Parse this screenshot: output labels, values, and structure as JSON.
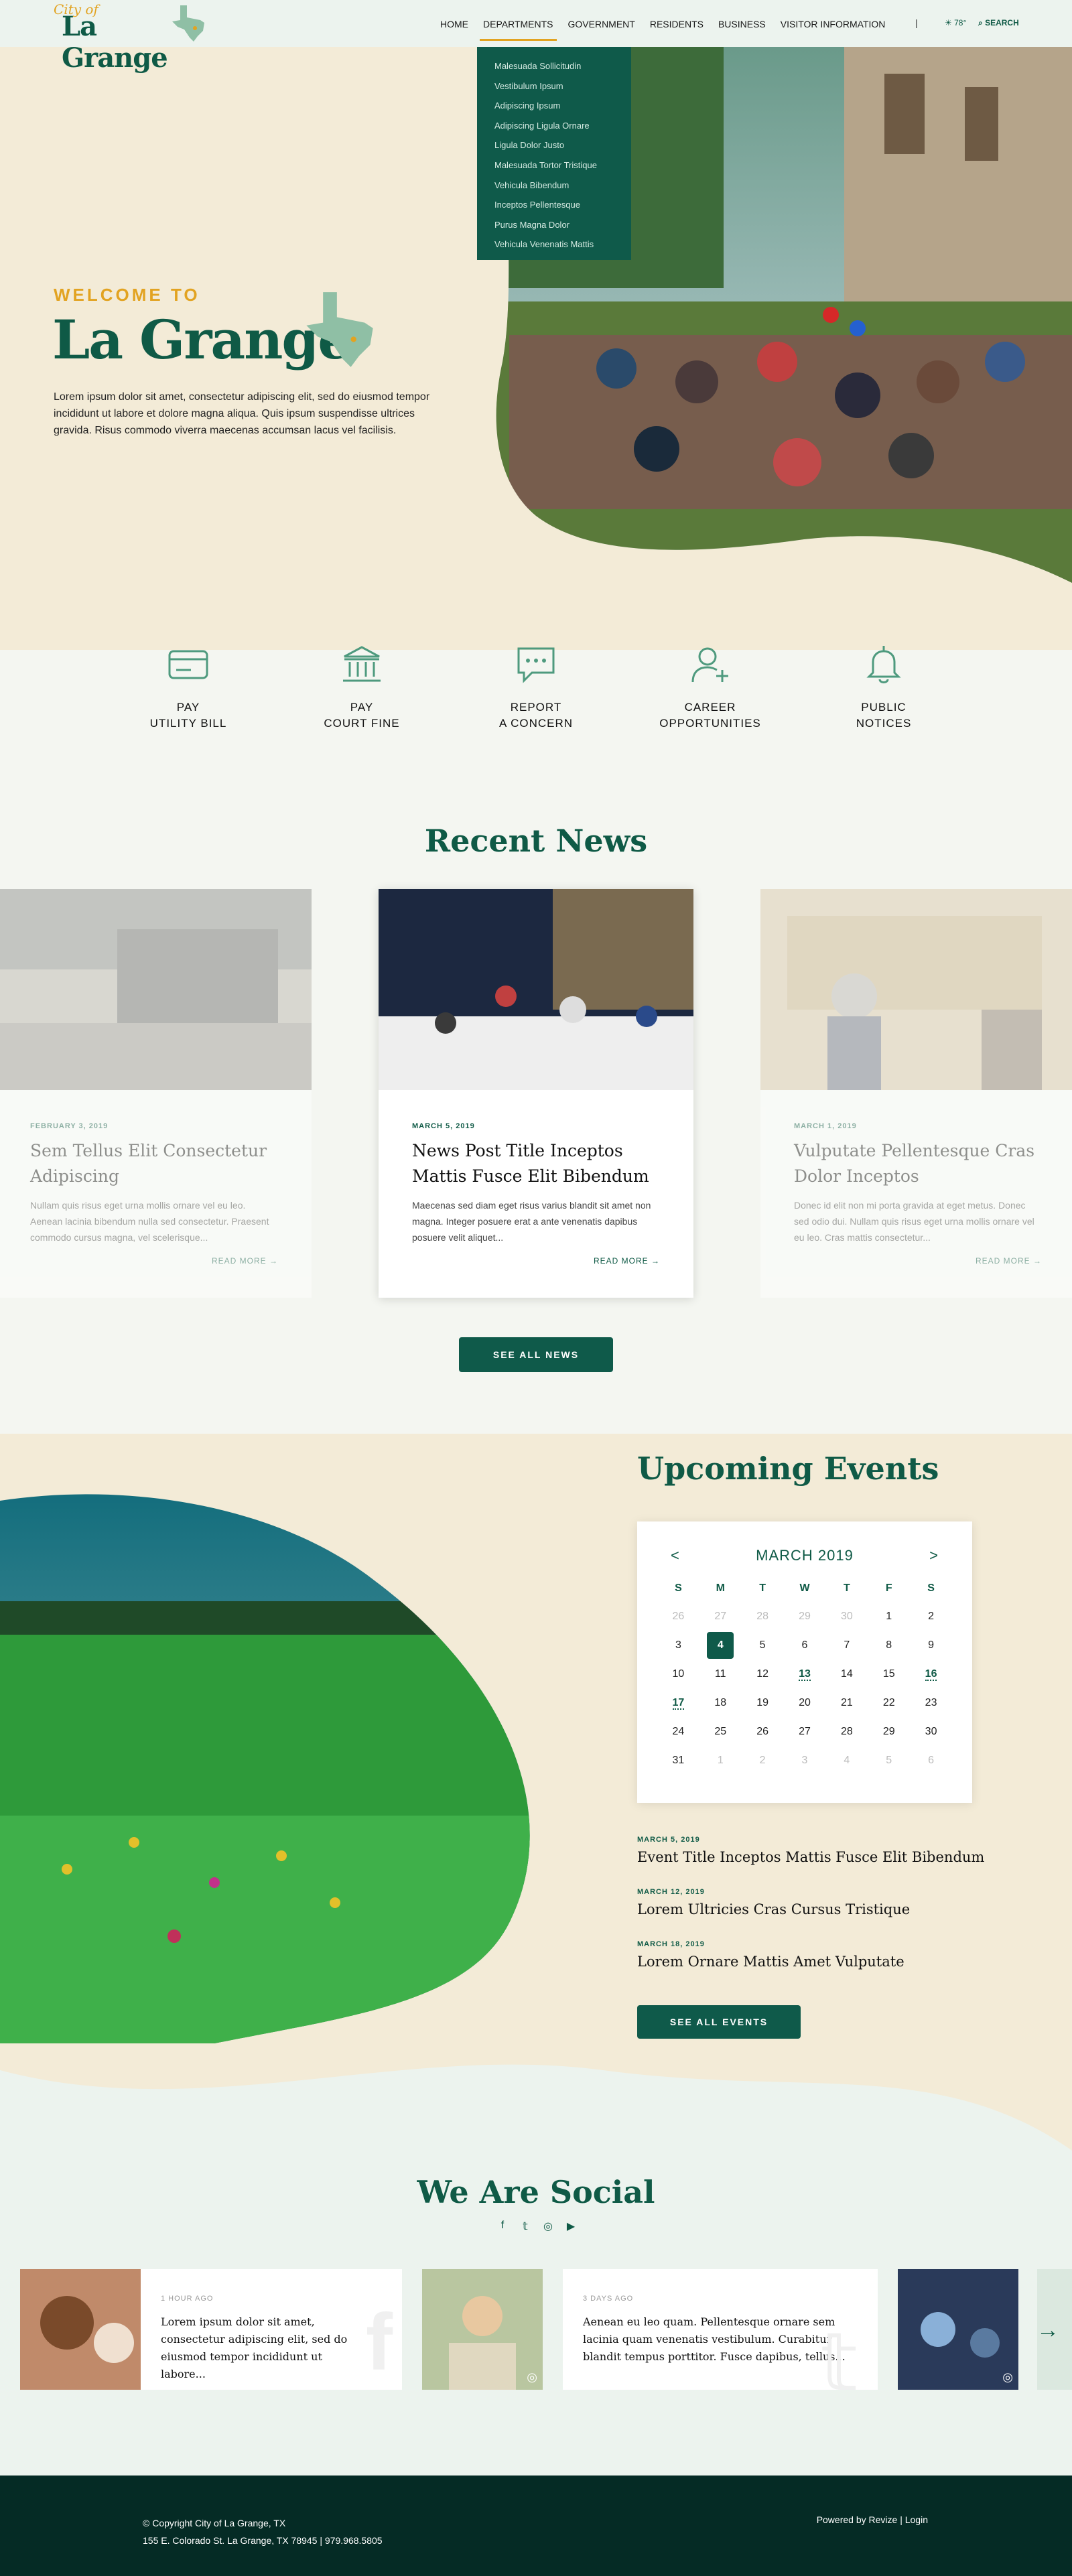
{
  "header": {
    "logo": {
      "city": "City of",
      "name": "La Grange"
    },
    "nav": [
      "HOME",
      "DEPARTMENTS",
      "GOVERNMENT",
      "RESIDENTS",
      "BUSINESS",
      "VISITOR INFORMATION"
    ],
    "separator": "|",
    "weather": "78°",
    "search": "SEARCH"
  },
  "dropdown": [
    "Malesuada Sollicitudin",
    "Vestibulum Ipsum",
    "Adipiscing Ipsum",
    "Adipiscing Ligula Ornare",
    "Ligula Dolor Justo",
    "Malesuada Tortor Tristique",
    "Vehicula Bibendum",
    "Inceptos Pellentesque",
    "Purus Magna Dolor",
    "Vehicula Venenatis Mattis"
  ],
  "hero": {
    "welcome": "WELCOME TO",
    "title": "La Grange",
    "text": "Lorem ipsum dolor sit amet, consectetur adipiscing elit, sed do eiusmod tempor incididunt ut labore et dolore magna aliqua. Quis ipsum suspendisse ultrices gravida. Risus commodo viverra maecenas accumsan lacus vel facilisis."
  },
  "quick_links": [
    {
      "line1": "PAY",
      "line2": "UTILITY BILL",
      "icon": "credit-card-icon"
    },
    {
      "line1": "PAY",
      "line2": "COURT FINE",
      "icon": "courthouse-icon"
    },
    {
      "line1": "REPORT",
      "line2": "A CONCERN",
      "icon": "chat-bubble-icon"
    },
    {
      "line1": "CAREER",
      "line2": "OPPORTUNITIES",
      "icon": "add-user-icon"
    },
    {
      "line1": "PUBLIC",
      "line2": "NOTICES",
      "icon": "bell-icon"
    }
  ],
  "news": {
    "title": "Recent News",
    "items": [
      {
        "date": "FEBRUARY 3, 2019",
        "title": "Sem Tellus Elit Consectetur Adipiscing",
        "text": "Nullam quis risus eget urna mollis ornare vel eu leo. Aenean lacinia bibendum nulla sed consectetur. Praesent commodo cursus magna, vel scelerisque...",
        "more": "READ MORE"
      },
      {
        "date": "MARCH 5, 2019",
        "title": "News Post Title Inceptos Mattis Fusce Elit Bibendum",
        "text": "Maecenas sed diam eget risus varius blandit sit amet non magna. Integer posuere erat a ante venenatis dapibus posuere velit aliquet...",
        "more": "READ MORE"
      },
      {
        "date": "MARCH 1, 2019",
        "title": "Vulputate Pellentesque Cras Dolor Inceptos",
        "text": "Donec id elit non mi porta gravida at eget metus. Donec sed odio dui. Nullam quis risus eget urna mollis ornare vel eu leo. Cras mattis consectetur...",
        "more": "READ MORE"
      }
    ],
    "button": "SEE ALL NEWS"
  },
  "events": {
    "title": "Upcoming Events",
    "calendar": {
      "prev": "<",
      "next": ">",
      "month": "MARCH 2019",
      "days": [
        "S",
        "M",
        "T",
        "W",
        "T",
        "F",
        "S"
      ],
      "weeks": [
        [
          "26",
          "27",
          "28",
          "29",
          "30",
          "1",
          "2"
        ],
        [
          "3",
          "4",
          "5",
          "6",
          "7",
          "8",
          "9"
        ],
        [
          "10",
          "11",
          "12",
          "13",
          "14",
          "15",
          "16"
        ],
        [
          "17",
          "18",
          "19",
          "20",
          "21",
          "22",
          "23"
        ],
        [
          "24",
          "25",
          "26",
          "27",
          "28",
          "29",
          "30"
        ],
        [
          "31",
          "1",
          "2",
          "3",
          "4",
          "5",
          "6"
        ]
      ]
    },
    "items": [
      {
        "date": "MARCH 5, 2019",
        "title": "Event Title Inceptos Mattis Fusce Elit Bibendum"
      },
      {
        "date": "MARCH 12, 2019",
        "title": "Lorem Ultricies Cras Cursus Tristique"
      },
      {
        "date": "MARCH 18, 2019",
        "title": "Lorem Ornare Mattis Amet Vulputate"
      }
    ],
    "button": "SEE ALL EVENTS"
  },
  "social": {
    "title": "We Are Social",
    "icons": [
      "facebook-icon",
      "twitter-icon",
      "instagram-icon",
      "youtube-icon"
    ],
    "posts": [
      {
        "time": "1 HOUR AGO",
        "text": "Lorem ipsum dolor sit amet, consectetur adipiscing elit, sed do eiusmod tempor incididunt ut labore..."
      },
      {
        "time": "3 DAYS AGO",
        "text": "Aenean eu leo quam. Pellentesque ornare sem lacinia quam venenatis vestibulum. Curabitur blandit tempus porttitor. Fusce dapibus, tellus..."
      }
    ]
  },
  "footer": {
    "copyright": "© Copyright City of La Grange, TX",
    "address": "155 E. Colorado St. La Grange, TX 78945",
    "sep": "|",
    "phone": "979.968.5805",
    "powered": "Powered by Revize",
    "login": "Login"
  },
  "colors": {
    "primary": "#0f5a46",
    "accent": "#e2a321",
    "cream": "#f3ebd7",
    "footer": "#052b25"
  }
}
